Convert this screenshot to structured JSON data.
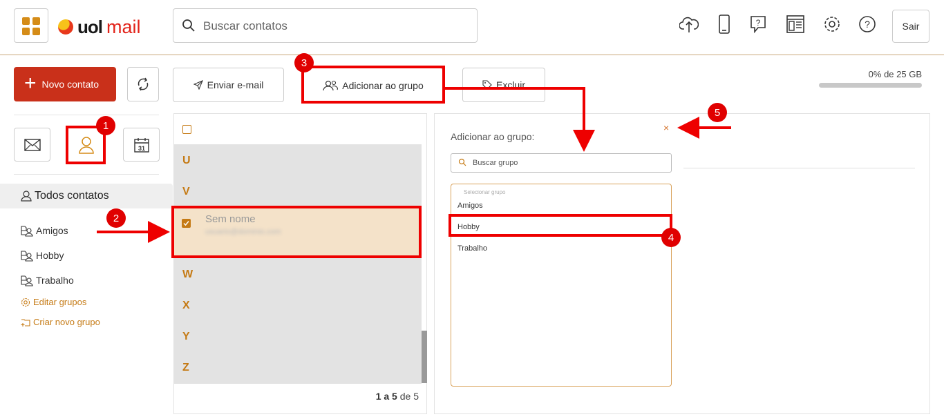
{
  "header": {
    "logo_uol": "uol",
    "logo_mail": "mail",
    "search_placeholder": "Buscar contatos",
    "sair_label": "Sair",
    "icons": [
      "apps-grid-icon",
      "cloud-upload-icon",
      "mobile-phone-icon",
      "help-chat-icon",
      "layout-icon",
      "gear-icon",
      "help-circle-icon"
    ]
  },
  "sidebar": {
    "new_contact_label": "Novo contato",
    "all_contacts_label": "Todos contatos",
    "groups": [
      {
        "label": "Amigos"
      },
      {
        "label": "Hobby"
      },
      {
        "label": "Trabalho"
      }
    ],
    "edit_groups_label": "Editar grupos",
    "new_group_label": "Criar novo grupo"
  },
  "toolbar": {
    "send_email_label": "Enviar e-mail",
    "add_group_label": "Adicionar ao grupo",
    "delete_label": "Excluir",
    "quota_text": "0% de 25 GB",
    "quota_percent": 0
  },
  "contacts": {
    "letters": [
      "U",
      "V",
      "W",
      "X",
      "Y",
      "Z"
    ],
    "selected_contact": {
      "name": "Sem nome",
      "email": "usuario@dominio.com"
    },
    "pager": {
      "range": "1 a 5",
      "of": "de",
      "total": "5"
    }
  },
  "group_panel": {
    "title": "Adicionar ao grupo:",
    "close_symbol": "×",
    "search_placeholder": "Buscar grupo",
    "caption": "Selecionar grupo",
    "options": [
      {
        "label": "Amigos"
      },
      {
        "label": "Hobby"
      },
      {
        "label": "Trabalho"
      }
    ]
  },
  "annotations": {
    "badges": [
      "1",
      "2",
      "3",
      "4",
      "5"
    ]
  },
  "colors": {
    "accent": "#d58c18",
    "brand_red": "#c9301a",
    "annotation_red": "#ee0000",
    "selected_row": "#f4e2c9"
  }
}
